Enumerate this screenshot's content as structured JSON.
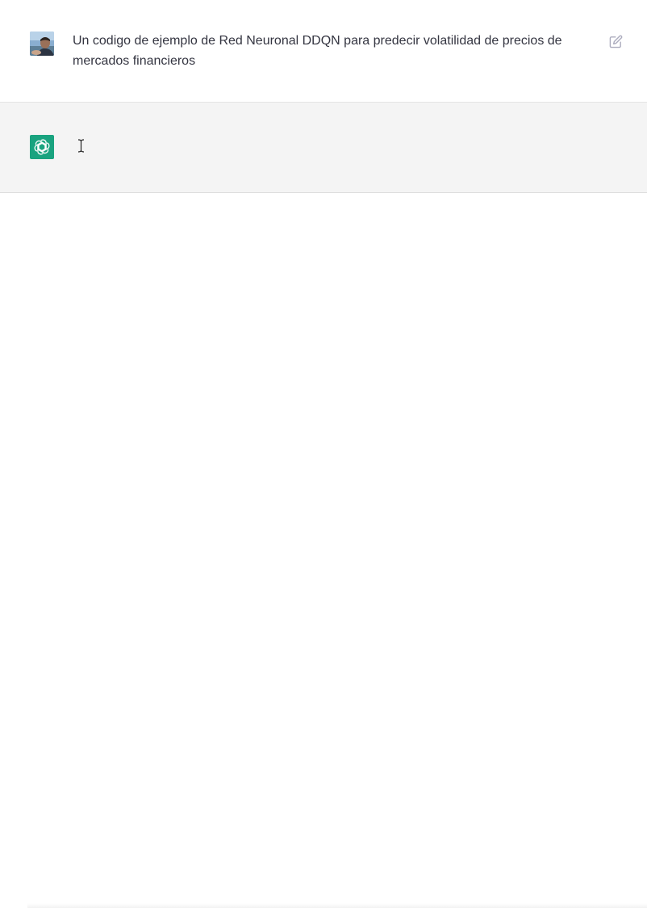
{
  "conversation": {
    "user_message": {
      "text": "Un codigo de ejemplo de Red Neuronal DDQN para predecir volatilidad de precios de mercados financieros",
      "avatar_icon": "user-avatar-photo",
      "edit_icon": "edit-icon"
    },
    "assistant_message": {
      "text": "",
      "avatar_icon": "openai-logo-icon",
      "avatar_color": "#19a37f"
    }
  },
  "colors": {
    "user_bg": "#ffffff",
    "assistant_bg": "#f4f4f4",
    "text": "#343541"
  }
}
